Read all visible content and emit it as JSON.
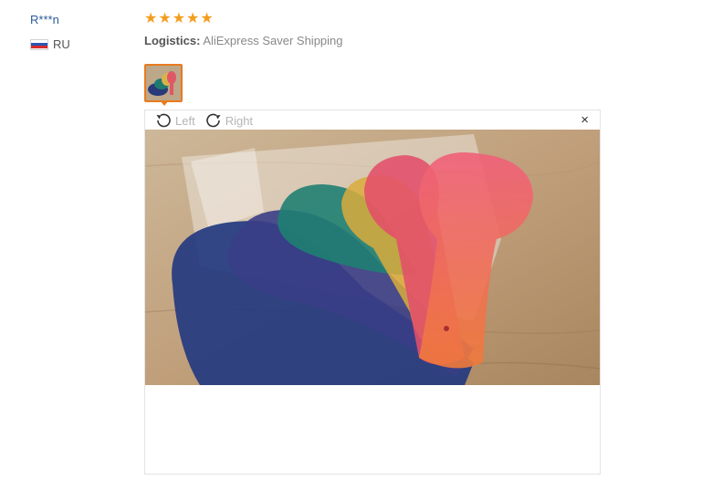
{
  "reviewer": {
    "name": "R***n",
    "country": "RU",
    "flag_icon": "russia-flag-icon"
  },
  "review": {
    "rating": 5,
    "rating_max": 5,
    "star_color": "#f49d1d",
    "logistics_label": "Logistics:",
    "logistics_value": "AliExpress Saver Shipping"
  },
  "viewer": {
    "rotate_left_label": "Left",
    "rotate_right_label": "Right",
    "close_symbol": "×",
    "accent_color": "#e87b1f"
  }
}
